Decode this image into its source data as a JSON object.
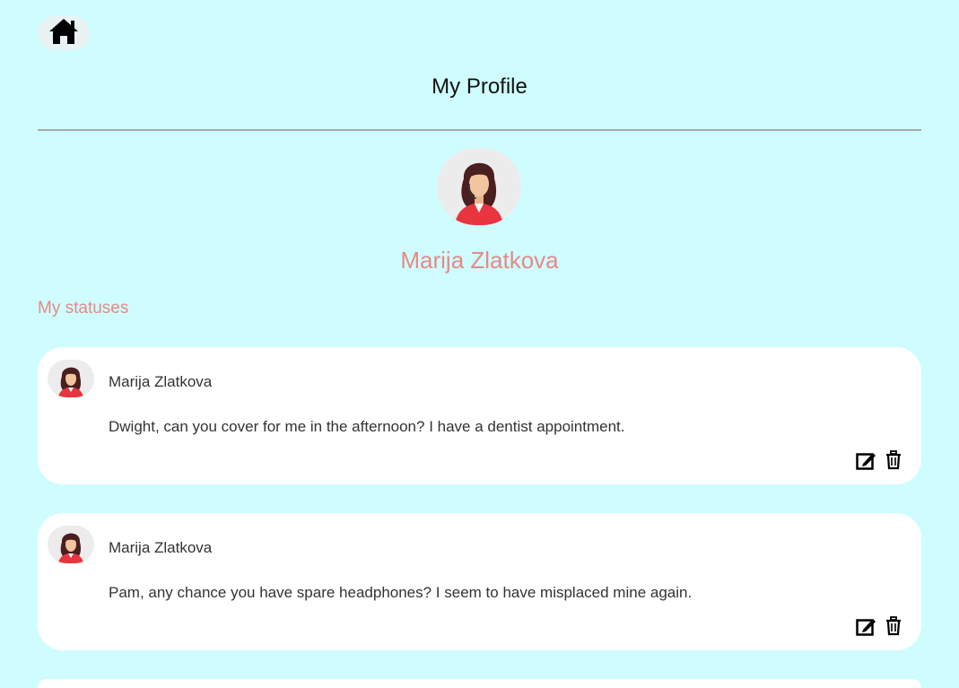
{
  "nav": {
    "home_icon": "house-icon"
  },
  "header": {
    "title": "My Profile"
  },
  "profile": {
    "name": "Marija Zlatkova",
    "avatar_icon": "woman-headset-avatar"
  },
  "section": {
    "heading": "My statuses"
  },
  "statuses": [
    {
      "author": "Marija Zlatkova",
      "text": "Dwight, can you cover for me in the afternoon? I have a dentist appointment.",
      "edit_icon": "edit-icon",
      "delete_icon": "trash-icon"
    },
    {
      "author": "Marija Zlatkova",
      "text": "Pam, any chance you have spare headphones? I seem to have misplaced mine again.",
      "edit_icon": "edit-icon",
      "delete_icon": "trash-icon"
    }
  ],
  "colors": {
    "background": "#cffdff",
    "accent": "#e58a86",
    "card": "#ffffff",
    "divider": "#a9a9a9"
  }
}
